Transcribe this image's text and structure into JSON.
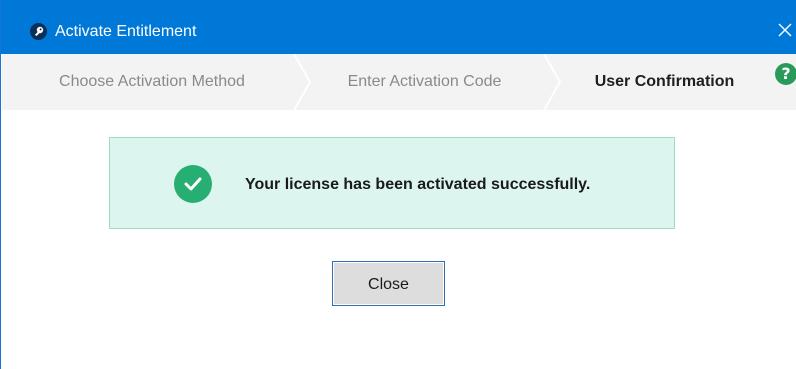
{
  "window": {
    "title": "Activate Entitlement",
    "title_icon": "key-icon",
    "close_icon": "close-icon"
  },
  "steps": [
    {
      "label": "Choose Activation Method",
      "state": "completed"
    },
    {
      "label": "Enter Activation Code",
      "state": "completed"
    },
    {
      "label": "User Confirmation",
      "state": "current"
    }
  ],
  "help": {
    "glyph": "?",
    "icon": "help-icon"
  },
  "message": {
    "text": "Your license has been activated successfully.",
    "icon": "checkmark-icon"
  },
  "buttons": {
    "close_label": "Close"
  },
  "colors": {
    "titlebar": "#0078d7",
    "success_bg": "#dcf6ef",
    "success_icon": "#27ae73",
    "help_icon": "#2a9a5a"
  }
}
